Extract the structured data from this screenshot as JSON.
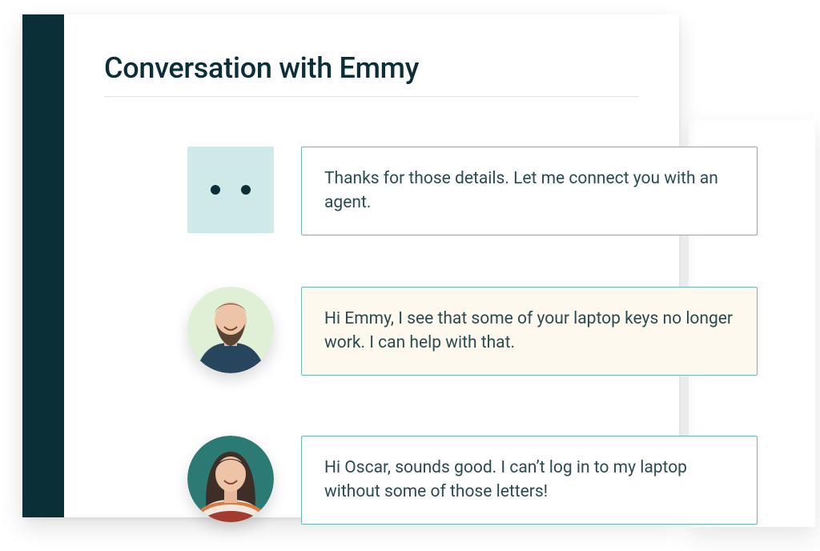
{
  "header": {
    "title": "Conversation with Emmy"
  },
  "colors": {
    "sidebar": "#0b2f36",
    "bot_avatar_bg": "#cfe9e9",
    "bubble_border": "#6fb7b4",
    "highlight_bg": "#fdf9ef",
    "text": "#2b4b52"
  },
  "messages": [
    {
      "sender": "bot",
      "avatar": "bot-icon",
      "text": "Thanks for those details. Let me connect you with an agent.",
      "highlight": false
    },
    {
      "sender": "agent",
      "avatar": "agent-oscar",
      "text": "Hi Emmy, I see that some of your laptop keys no longer work. I can help with that.",
      "highlight": true
    },
    {
      "sender": "customer",
      "avatar": "customer-emmy",
      "text": "Hi Oscar, sounds good. I can’t log in to my laptop without some of those letters!",
      "highlight": false
    }
  ]
}
